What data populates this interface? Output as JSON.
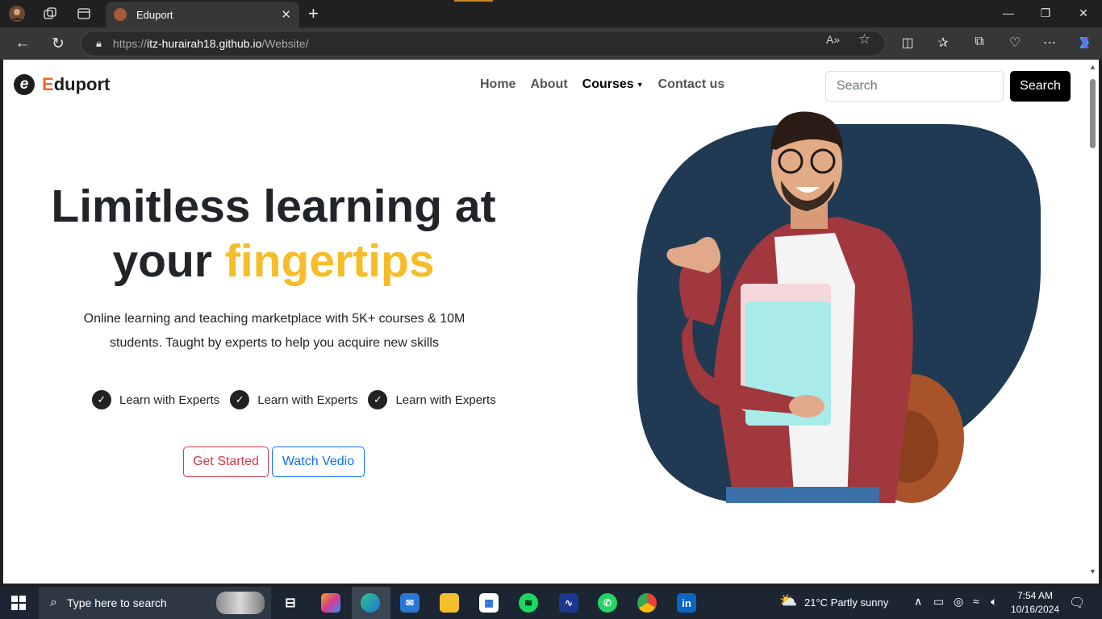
{
  "browser": {
    "tab_title": "Eduport",
    "url_protocol": "https://",
    "url_host": "itz-hurairah18.github.io",
    "url_path": "/Website/"
  },
  "site": {
    "logo_initial": "E",
    "logo_rest": "duport",
    "logo_mark": "e",
    "nav": [
      "Home",
      "About",
      "Courses",
      "Contact us"
    ],
    "search_placeholder": "Search",
    "search_button": "Search",
    "headline_line1": "Limitless learning at",
    "headline_prefix": "your",
    "headline_highlight": "fingertips",
    "subtext": "Online learning and teaching marketplace with 5K+ courses & 10M students. Taught by experts to help you acquire new skills",
    "features": [
      "Learn with Experts",
      "Learn with Experts",
      "Learn with Experts"
    ],
    "primary_button": "Get Started",
    "secondary_button": "Watch Vedio",
    "colors": {
      "highlight": "#f6bd28",
      "logo_accent": "#e8692c",
      "hero_blob": "#1f3a52",
      "primary": "#dc3545",
      "secondary": "#0d6efd"
    }
  },
  "taskbar": {
    "search_placeholder": "Type here to search",
    "weather": "21°C  Partly sunny",
    "time": "7:54 AM",
    "date": "10/16/2024"
  }
}
